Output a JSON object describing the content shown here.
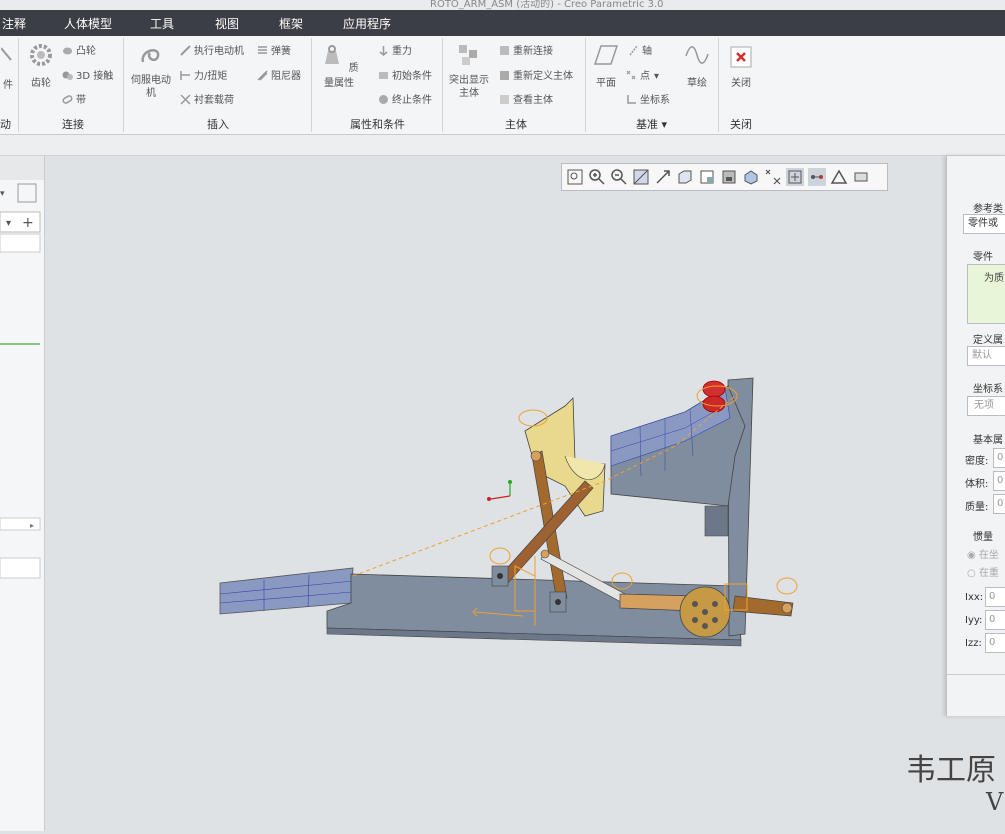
{
  "title": "ROTO_ARM_ASM (活动的) - Creo Parametric 3.0",
  "menu": [
    "注释",
    "人体模型",
    "工具",
    "视图",
    "框架",
    "应用程序"
  ],
  "ribbon": {
    "g1": {
      "frag": "件",
      "group": "动"
    },
    "g2": {
      "gear": "齿轮",
      "cam": "凸轮",
      "joint3d": "3D 接触",
      "belt": "带",
      "group": "连接"
    },
    "g3": {
      "servo": "伺服电动机",
      "actuator": "执行电动机",
      "spring": "弹簧",
      "force": "力/扭矩",
      "damper": "阻尼器",
      "bushing": "衬套载荷",
      "group": "插入"
    },
    "g4": {
      "mass": "质量属性",
      "gravity": "重力",
      "initial": "初始条件",
      "terminate": "终止条件",
      "group": "属性和条件"
    },
    "g5": {
      "highlight": "突出显示主体",
      "reconnect": "重新连接",
      "redefine": "重新定义主体",
      "view": "查看主体",
      "group": "主体"
    },
    "g6": {
      "plane": "平面",
      "axis": "轴",
      "point": "点",
      "csys": "坐标系",
      "sketch": "草绘",
      "group": "基准"
    },
    "g7": {
      "close": "关闭",
      "group": "关闭"
    }
  },
  "dialog": {
    "ref_type_label": "参考类",
    "ref_type_value": "零件或",
    "part_label": "零件",
    "part_value": "为质",
    "define_label": "定义属",
    "define_value": "默认",
    "csys_label": "坐标系",
    "csys_value": "无项",
    "basic_label": "基本属",
    "density_label": "密度:",
    "volume_label": "体积:",
    "mass_label": "质量:",
    "zero": "0",
    "inertia_label": "惯量",
    "at_csys": "在坐",
    "at_center": "在重",
    "ixx": "Ixx:",
    "iyy": "Iyy:",
    "izz": "Izz:"
  },
  "watermark": {
    "line1": "韦工原",
    "line2": "V"
  },
  "colors": {
    "menubar": "#3b3f45",
    "viewport": "#dfe2e5",
    "part_gray": "#7f8d9f",
    "part_yellow": "#e8d98c",
    "link_brown": "#a36a2e",
    "close_red": "#d23030"
  }
}
